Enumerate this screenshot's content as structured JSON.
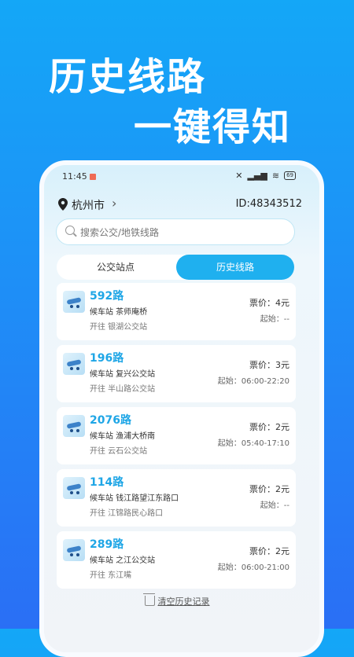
{
  "promo": {
    "line1": "历史线路",
    "line2": "一键得知"
  },
  "status": {
    "time": "11:45",
    "battery": "69"
  },
  "header": {
    "city": "杭州市",
    "user_id": "ID:48343512"
  },
  "search": {
    "placeholder": "搜索公交/地铁线路"
  },
  "tabs": [
    {
      "label": "公交站点"
    },
    {
      "label": "历史线路"
    }
  ],
  "routes": [
    {
      "name": "592路",
      "station": "候车站 茶师庵桥",
      "direction": "开往 银湖公交站",
      "price": "票价：4元",
      "hours": "起始：--"
    },
    {
      "name": "196路",
      "station": "候车站 复兴公交站",
      "direction": "开往 半山路公交站",
      "price": "票价：3元",
      "hours": "起始：06:00-22:20"
    },
    {
      "name": "2076路",
      "station": "候车站 渔浦大桥南",
      "direction": "开往 云石公交站",
      "price": "票价：2元",
      "hours": "起始：05:40-17:10"
    },
    {
      "name": "114路",
      "station": "候车站 钱江路望江东路口",
      "direction": "开往 江锦路民心路口",
      "price": "票价：2元",
      "hours": "起始：--"
    },
    {
      "name": "289路",
      "station": "候车站 之江公交站",
      "direction": "开往 东江嘴",
      "price": "票价：2元",
      "hours": "起始：06:00-21:00"
    }
  ],
  "footer": {
    "clear_label": "清空历史记录"
  },
  "colors": {
    "accent": "#1fb0ef",
    "route_name": "#1fa6e6"
  }
}
